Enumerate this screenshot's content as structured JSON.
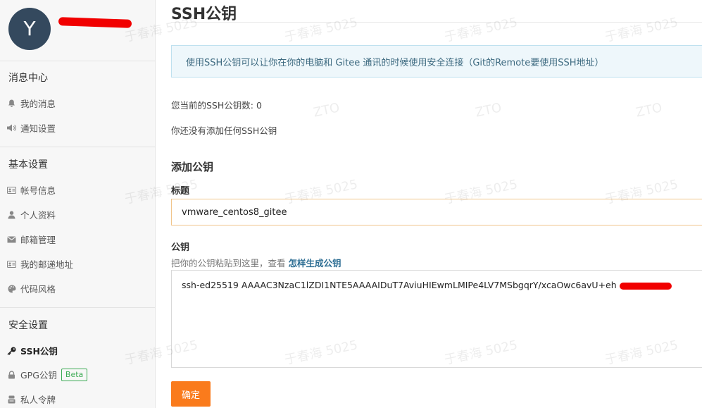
{
  "profile": {
    "avatar_letter": "Y"
  },
  "sidebar": {
    "sections": [
      {
        "title": "消息中心",
        "items": [
          {
            "label": "我的消息",
            "icon": "bell-icon"
          },
          {
            "label": "通知设置",
            "icon": "speaker-icon"
          }
        ]
      },
      {
        "title": "基本设置",
        "items": [
          {
            "label": "帐号信息",
            "icon": "id-card-icon"
          },
          {
            "label": "个人资料",
            "icon": "user-icon"
          },
          {
            "label": "邮箱管理",
            "icon": "mail-icon"
          },
          {
            "label": "我的邮递地址",
            "icon": "address-card-icon"
          },
          {
            "label": "代码风格",
            "icon": "palette-icon"
          }
        ]
      },
      {
        "title": "安全设置",
        "items": [
          {
            "label": "SSH公钥",
            "icon": "key-icon",
            "active": true
          },
          {
            "label": "GPG公钥",
            "icon": "lock-icon",
            "badge": "Beta"
          },
          {
            "label": "私人令牌",
            "icon": "token-icon"
          }
        ]
      }
    ]
  },
  "main": {
    "title": "SSH公钥",
    "info": "使用SSH公钥可以让你在你的电脑和 Gitee 通讯的时候使用安全连接（Git的Remote要使用SSH地址）",
    "count_text": "您当前的SSH公钥数: 0",
    "empty_text": "你还没有添加任何SSH公钥",
    "add_heading": "添加公钥",
    "title_label": "标题",
    "title_value": "vmware_centos8_gitee",
    "key_label": "公钥",
    "hint_prefix": "把你的公钥粘贴到这里，查看",
    "hint_link": "怎样生成公钥",
    "key_value": "ssh-ed25519 AAAAC3NzaC1lZDI1NTE5AAAAIDuT7AviuHIEwmLMIPe4LV7MSbgqrY/xcaOwc6avU+eh",
    "submit": "确定"
  },
  "watermark": {
    "text": "于春海 5025",
    "alt": "ZTO"
  },
  "colors": {
    "accent": "#fa7b1c",
    "info_bg": "#eef7fb",
    "beta": "#3dab55",
    "redaction": "#f10000"
  }
}
